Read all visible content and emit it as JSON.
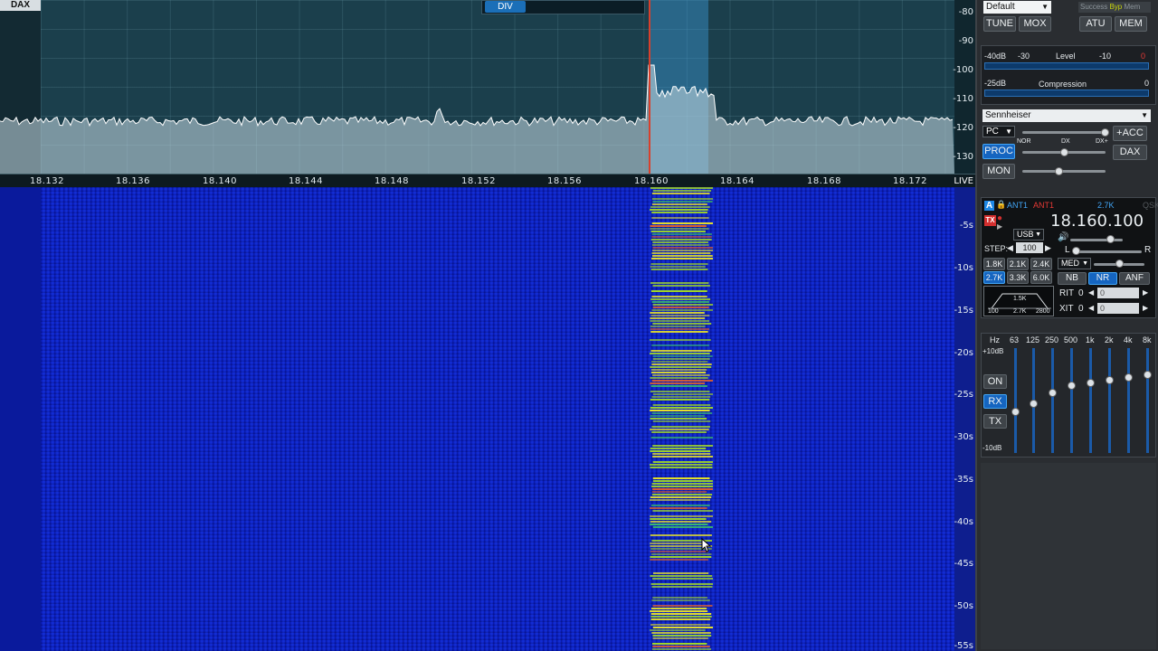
{
  "panadapter": {
    "dax_tag": "DAX",
    "div_button": "DIV",
    "live_label": "LIVE",
    "db_scale": [
      "-80",
      "-90",
      "-100",
      "-110",
      "-120",
      "-130"
    ],
    "freq_labels": [
      "18.132",
      "18.136",
      "18.140",
      "18.144",
      "18.148",
      "18.152",
      "18.156",
      "18.160",
      "18.164",
      "18.168",
      "18.172"
    ]
  },
  "waterfall": {
    "time_labels": [
      "-5s",
      "-10s",
      "-15s",
      "-20s",
      "-25s",
      "-30s",
      "-35s",
      "-40s",
      "-45s",
      "-50s",
      "-55s"
    ]
  },
  "panel": {
    "profile_dropdown": "Default",
    "status_success": "Success",
    "status_byp": "Byp",
    "status_mem": "Mem",
    "tune_label": "TUNE",
    "mox_label": "MOX",
    "atu_label": "ATU",
    "mem_label": "MEM",
    "level_meter": {
      "scale_left": "-40dB",
      "scale_mid": "-30",
      "title": "Level",
      "scale_right": "-10",
      "scale_end": "0"
    },
    "compression_meter": {
      "scale_left": "-25dB",
      "title": "Compression",
      "scale_end": "0"
    },
    "mic_profile": "Sennheiser",
    "mic_input": "PC",
    "acc_label": "+ACC",
    "proc_label": "PROC",
    "dax_label": "DAX",
    "proc_nor": "NOR",
    "proc_dx": "DX",
    "proc_dxplus": "DX+",
    "mon_label": "MON",
    "slice": {
      "slice_letter": "A",
      "rx_ant": "ANT1",
      "tx_ant": "ANT1",
      "tx_badge": "TX",
      "bandwidth": "2.7K",
      "qsk": "QSK",
      "frequency": "18.160.100",
      "mode": "USB",
      "step_label": "STEP:",
      "step_value": "100",
      "agc_mode": "MED",
      "pan_l": "L",
      "pan_r": "R",
      "filters": [
        "1.8K",
        "2.1K",
        "2.4K",
        "2.7K",
        "3.3K",
        "6.0K"
      ],
      "nb_label": "NB",
      "nr_label": "NR",
      "anf_label": "ANF",
      "rit_label": "RIT",
      "rit_value": "0",
      "rit_offset": "0",
      "xit_label": "XIT",
      "xit_value": "0",
      "xit_offset": "0",
      "filter_graph_top": "1.5K",
      "filter_graph_left": "100",
      "filter_graph_mid": "2.7K",
      "filter_graph_right": "2800"
    },
    "eq": {
      "hz_label": "Hz",
      "bands": [
        "63",
        "125",
        "250",
        "500",
        "1k",
        "2k",
        "4k",
        "8k"
      ],
      "top_label": "+10dB",
      "bottom_label": "-10dB",
      "on_label": "ON",
      "rx_label": "RX",
      "tx_label": "TX",
      "levels_db": [
        -2,
        -0.5,
        1.5,
        3,
        3.5,
        4,
        4.5,
        5
      ]
    }
  }
}
